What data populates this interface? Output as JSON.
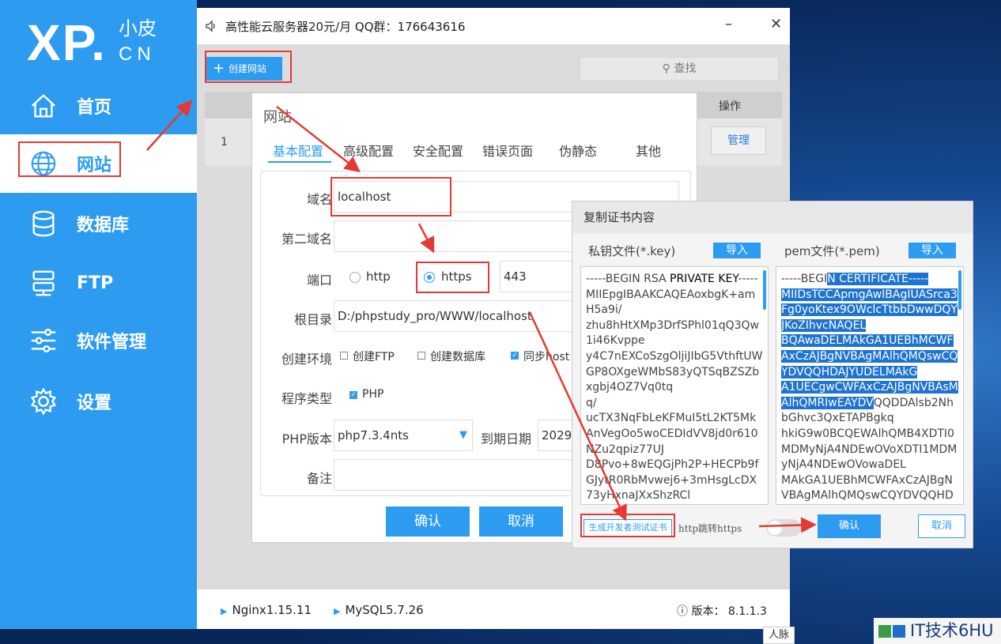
{
  "sidebar": {
    "logo": "XP.",
    "logo_cn_top": "小皮",
    "logo_cn_bottom": "CN",
    "items": [
      {
        "label": "首页",
        "icon": "home-icon"
      },
      {
        "label": "网站",
        "icon": "globe-icon",
        "active": true
      },
      {
        "label": "数据库",
        "icon": "database-icon"
      },
      {
        "label": "FTP",
        "icon": "server-icon"
      },
      {
        "label": "软件管理",
        "icon": "sliders-icon"
      },
      {
        "label": "设置",
        "icon": "gear-icon"
      }
    ]
  },
  "window": {
    "title": "高性能云服务器20元/月  QQ群：176643616",
    "minimize": "–",
    "close": "✕"
  },
  "toolbar": {
    "create_label": "创建网站",
    "search_label": "查找"
  },
  "table": {
    "header_action": "操作",
    "row_index": "1",
    "row_manage": "管理"
  },
  "statusbar": {
    "nginx": "Nginx1.15.11",
    "mysql": "MySQL5.7.26",
    "version": "版本： 8.1.1.3"
  },
  "site_dialog": {
    "title": "网站",
    "tabs": [
      "基本配置",
      "高级配置",
      "安全配置",
      "错误页面",
      "伪静态",
      "其他"
    ],
    "domain_label": "域名",
    "domain_value": "localhost",
    "second_domain_label": "第二域名",
    "port_label": "端口",
    "http_label": "http",
    "https_label": "https",
    "port_value": "443",
    "root_label": "根目录",
    "root_value": "D:/phpstudy_pro/WWW/localhost",
    "env_label": "创建环境",
    "env_ftp": "创建FTP",
    "env_db": "创建数据库",
    "env_sync": "同步host",
    "prog_label": "程序类型",
    "prog_php": "PHP",
    "php_label": "PHP版本",
    "php_value": "php7.3.4nts",
    "expire_label": "到期日期",
    "expire_value": "2029-",
    "note_label": "备注",
    "ok_label": "确认",
    "cancel_label": "取消"
  },
  "cert_dialog": {
    "title": "复制证书内容",
    "key_header": "私钥文件(*.key)",
    "pem_header": "pem文件(*.pem)",
    "import_label": "导入",
    "key_prefix": "-----BEGIN RSA ",
    "key_strong": "PRIVATE KEY",
    "key_suffix": "-----",
    "key_body": "MIIEpgIBAAKCAQEAoxbgK+amH5a9i/\nzhu8hHtXMp3DrfSPhl01qQ3Qw1i46Kvppe\ny4C7nEXCoSzgOljiJIbG5VthftUWGP8OXgeWMbS83yQTSqBZSZbxgbj4OZ7Vq0tq\nq/\nucTX3NqFbLeKFMuI5tL2KT5MkAnVegOo5woCEDIdVV8jd0r610NZu2qpiz77UJ\nD8Pvo+8wEQGjPh2P+HECPb9fGJytR0RbMvwej6+3mHsgLcDX73yHxnaJXxShzRCl",
    "pem_prefix": "-----BEGI",
    "pem_highlight": "N CERTIFICATE-----\nMIIDsTCCApmgAwIBAgIUASrca3Fg0yoKtex9OWclcTtbbDwwDQYJKoZIhvcNAQEL\nBQAwaDELMAkGA1UEBhMCWFAxCzAJBgNVBAgMAlhQMQswCQYDVQQHDAJYUDELMAkG\nA1UECgwCWFAxCzAJBgNVBAsMAlhQMRIwEAYDV",
    "pem_rest": "QQDDAlsb2NhbGhvc3QxETAPBgkq\nhkiG9w0BCQEWAlhQMB4XDTI0MDMyNjA4NDEwOVoXDTI1MDMyNjA4NDEwOVowaDEL\nMAkGA1UEBhMCWFAxCzAJBgNVBAgMAlhQMQswCQYDVQQHD",
    "gen_label": "生成开发者测试证书",
    "redirect_label": "http跳转https",
    "ok_label": "确认",
    "cancel_label": "取消"
  },
  "taskbar": {
    "renmai": "人脉",
    "watermark": "IT技术6HU"
  },
  "colors": {
    "accent": "#2d9cf0",
    "annotation": "#e53935"
  }
}
